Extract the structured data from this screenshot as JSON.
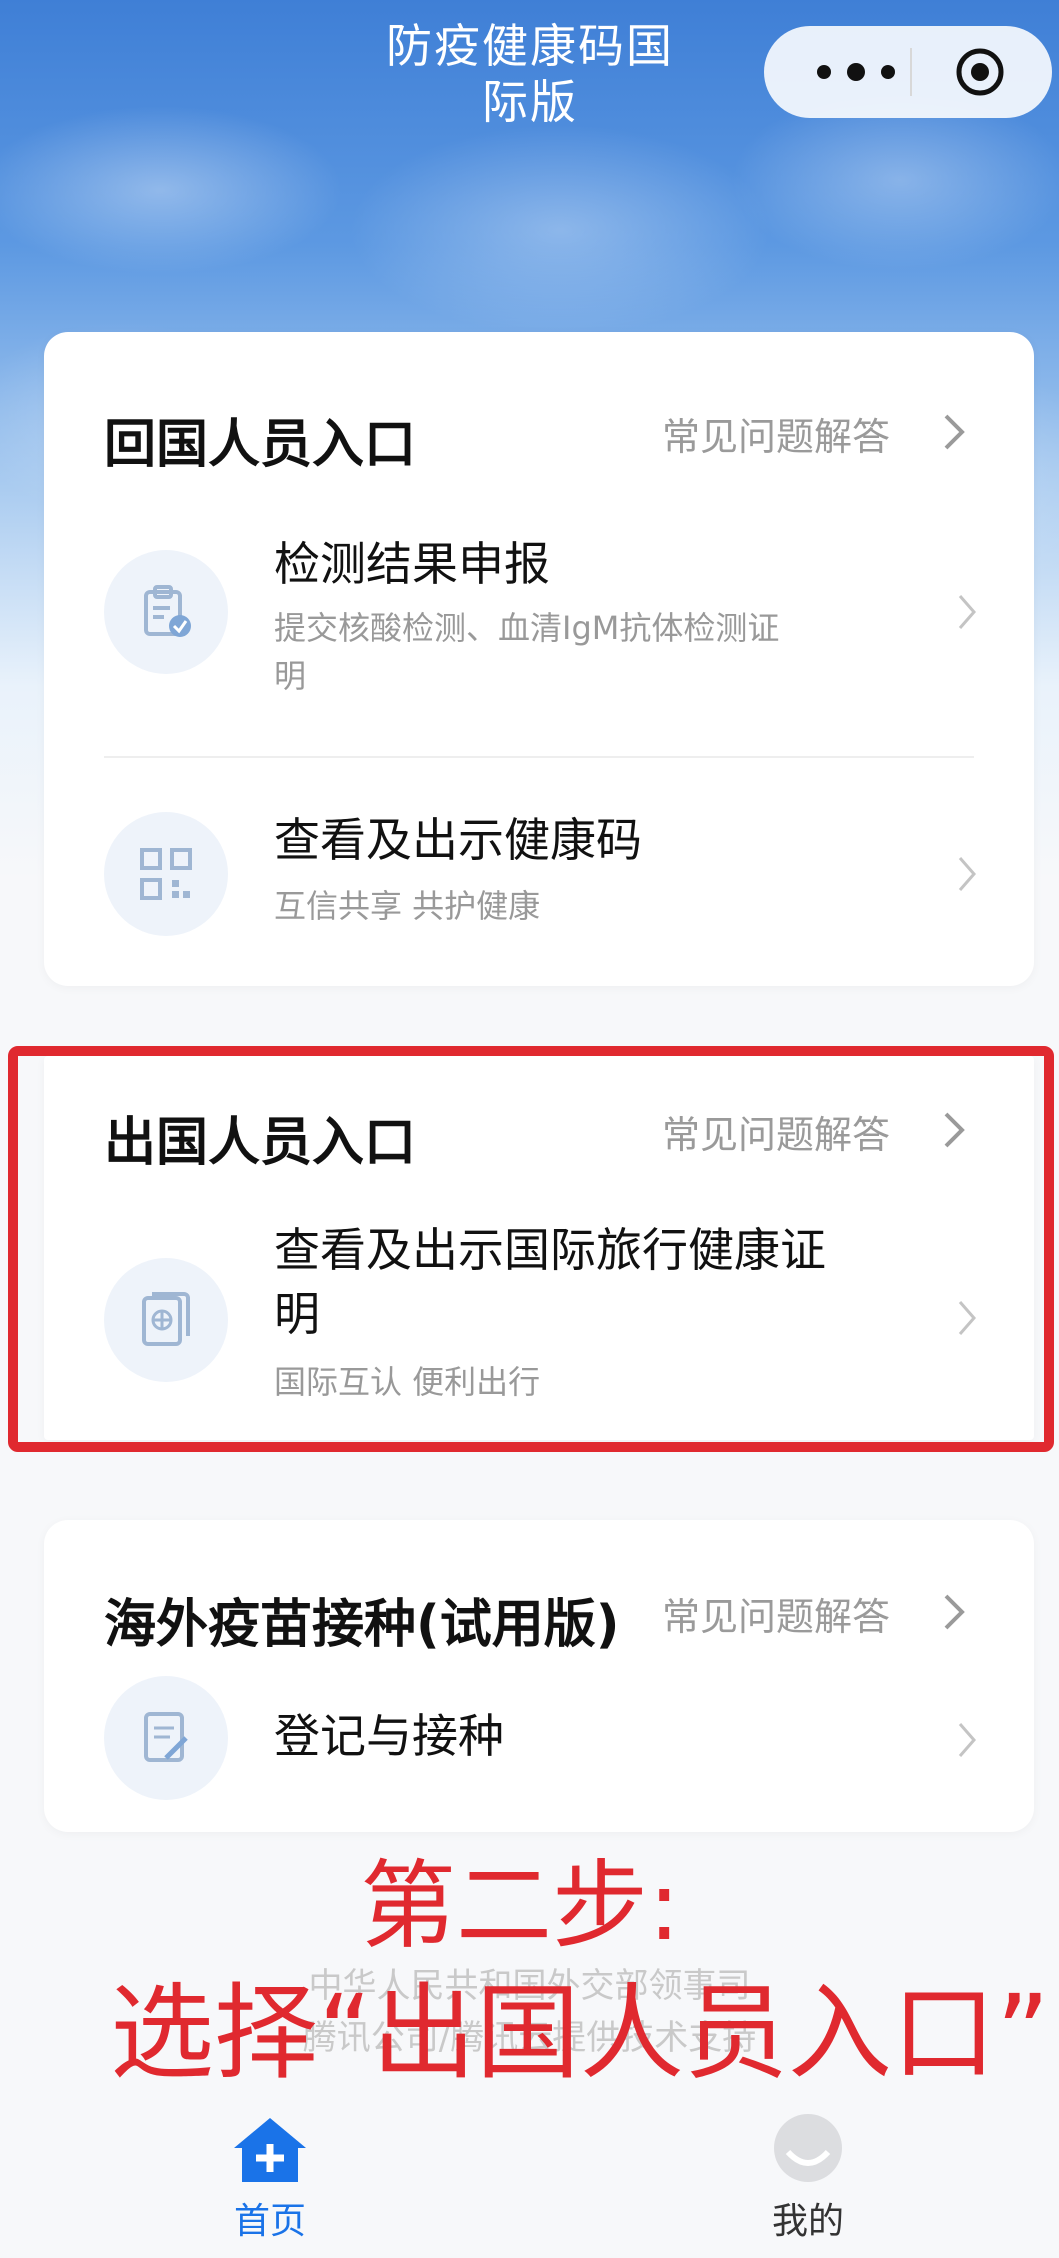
{
  "header": {
    "title_line1": "防疫健康码国",
    "title_line2": "际版"
  },
  "capsule": {
    "more_icon": "more-dots-icon",
    "close_icon": "target-circle-icon"
  },
  "return_section": {
    "title": "回国人员入口",
    "faq": "常见问题解答",
    "items": [
      {
        "title": "检测结果申报",
        "subtitle_line1": "提交核酸检测、血清IgM抗体检测证",
        "subtitle_line2": "明",
        "icon": "clipboard-check-icon"
      },
      {
        "title": "查看及出示健康码",
        "subtitle": "互信共享 共护健康",
        "icon": "qr-code-icon"
      }
    ]
  },
  "outbound_section": {
    "title": "出国人员入口",
    "faq": "常见问题解答",
    "items": [
      {
        "title_line1": "查看及出示国际旅行健康证",
        "title_line2": "明",
        "subtitle": "国际互认 便利出行",
        "icon": "passport-icon"
      }
    ]
  },
  "vaccine_section": {
    "title": "海外疫苗接种(试用版)",
    "faq": "常见问题解答",
    "items": [
      {
        "title": "登记与接种",
        "icon": "document-edit-icon"
      }
    ]
  },
  "footer": {
    "line1": "中华人民共和国外交部领事司",
    "line2": "腾讯公司/腾讯云提供技术支持"
  },
  "annotation": {
    "line1": "第二步:",
    "line2": "选择“出国人员入口”"
  },
  "tabbar": {
    "tabs": [
      {
        "label": "首页",
        "icon": "home-plus-icon",
        "active": true
      },
      {
        "label": "我的",
        "icon": "user-avatar-icon",
        "active": false
      }
    ]
  },
  "colors": {
    "accent": "#1a73e8",
    "annotation_red": "#e0292f"
  }
}
